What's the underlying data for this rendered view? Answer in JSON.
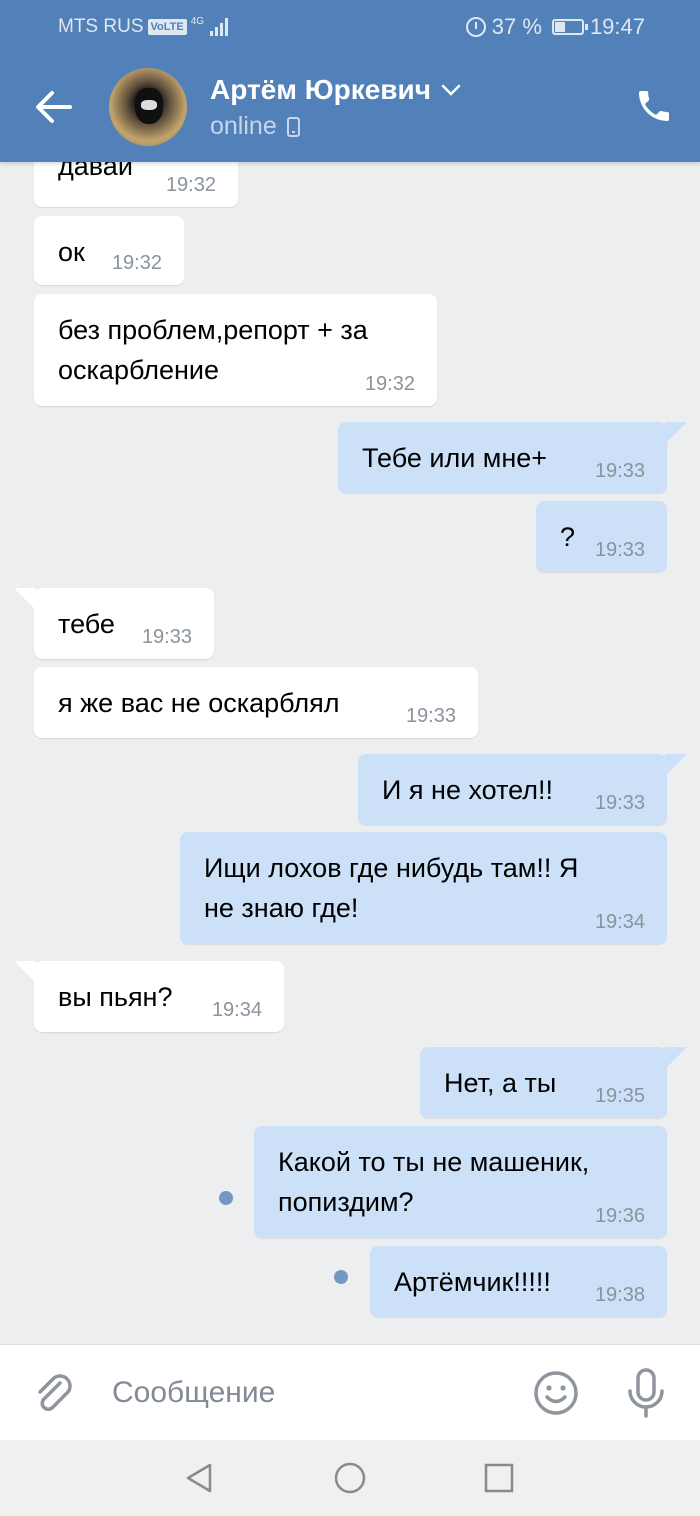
{
  "status_bar": {
    "carrier": "MTS RUS",
    "volte": "VoLTE",
    "network": "4G",
    "battery": "37 %",
    "battery_level": 0.37,
    "time": "19:47"
  },
  "header": {
    "contact_name": "Артём Юркевич",
    "contact_status": "online"
  },
  "messages": [
    {
      "dir": "in",
      "text": "давай",
      "time": "19:32"
    },
    {
      "dir": "in",
      "text": "ок",
      "time": "19:32"
    },
    {
      "dir": "in",
      "text": "без проблем,репорт + за\nоскарбление",
      "time": "19:32"
    },
    {
      "dir": "out",
      "text": "Тебе или мне+",
      "time": "19:33"
    },
    {
      "dir": "out",
      "text": "?",
      "time": "19:33"
    },
    {
      "dir": "in",
      "text": "тебе",
      "time": "19:33"
    },
    {
      "dir": "in",
      "text": "я же вас не оскарблял",
      "time": "19:33"
    },
    {
      "dir": "out",
      "text": "И я не хотел!!",
      "time": "19:33"
    },
    {
      "dir": "out",
      "text": "Ищи лохов где нибудь там!!  Я\nне знаю где!",
      "time": "19:34"
    },
    {
      "dir": "in",
      "text": "вы пьян?",
      "time": "19:34"
    },
    {
      "dir": "out",
      "text": "Нет, а ты",
      "time": "19:35"
    },
    {
      "dir": "out",
      "text": "Какой то ты не машеник,\nпопиздим?",
      "time": "19:36",
      "unread": true
    },
    {
      "dir": "out",
      "text": "Артёмчик!!!!!",
      "time": "19:38",
      "unread": true
    }
  ],
  "composer": {
    "placeholder": "Сообщение"
  },
  "colors": {
    "header": "#5181b8",
    "outgoing_bubble": "#cce1f8",
    "incoming_bubble": "#ffffff",
    "background": "#edeef0",
    "icon_gray": "#8f959d"
  }
}
